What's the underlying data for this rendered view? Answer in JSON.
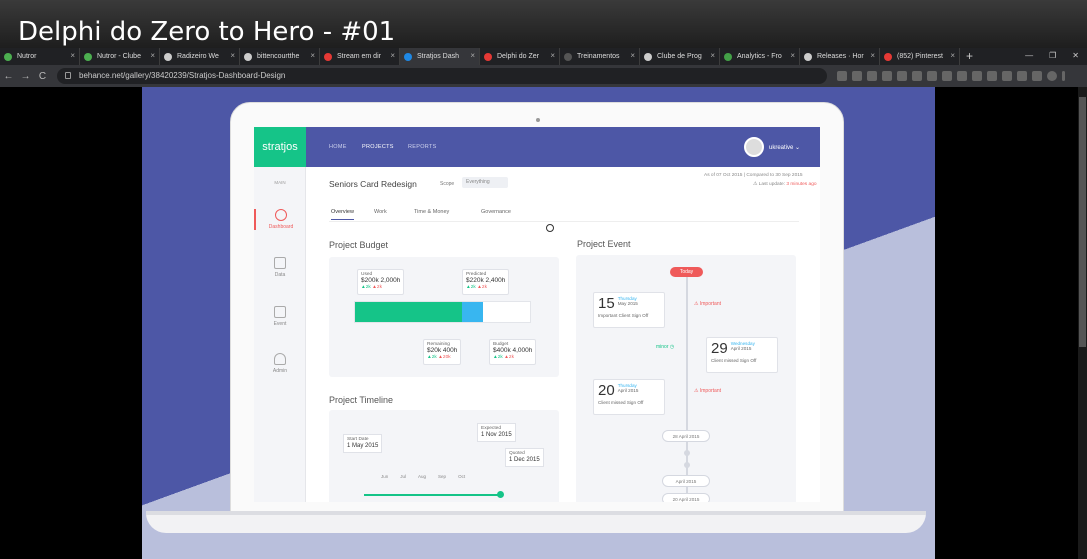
{
  "video": {
    "title": "Delphi do Zero to Hero - #01"
  },
  "browser": {
    "tabs": [
      {
        "label": "Nutror",
        "color": "#4caf50"
      },
      {
        "label": "Nutror - Clube",
        "color": "#4caf50"
      },
      {
        "label": "Radizeiro We",
        "color": "#cccccc"
      },
      {
        "label": "bittencourtthe",
        "color": "#cccccc"
      },
      {
        "label": "Stream em dir",
        "color": "#e53935"
      },
      {
        "label": "Stratjos Dash",
        "color": "#1e88e5"
      },
      {
        "label": "Delphi do Zer",
        "color": "#e53935"
      },
      {
        "label": "Treinamentos",
        "color": "#555555"
      },
      {
        "label": "Clube de Prog",
        "color": "#cccccc"
      },
      {
        "label": "Analytics - Fro",
        "color": "#43a047"
      },
      {
        "label": "Releases · Hor",
        "color": "#cccccc"
      },
      {
        "label": "(852) Pinterest",
        "color": "#e53935"
      }
    ],
    "active_tab": 5,
    "new_tab": "+",
    "url": "behance.net/gallery/38420239/Stratjos-Dashboard-Design",
    "back": "←",
    "forward": "→",
    "reload": "C",
    "win_min": "—",
    "win_max": "❐",
    "win_close": "✕"
  },
  "app": {
    "logo": "stratjos",
    "nav": [
      "HOME",
      "PROJECTS",
      "REPORTS"
    ],
    "active_nav": 1,
    "user": "ukreative",
    "user_caret": "⌄",
    "sidebar_main": "MAIN",
    "sidebar": [
      "Dashboard",
      "Data",
      "Event",
      "Admin"
    ],
    "project": "Seniors Card Redesign",
    "scope_label": "Scope",
    "scope_value": "Everything",
    "as_of": "As of 07 Oct 2015",
    "compared": "Compared to 30 Sep 2015",
    "last_update_label": "Last update:",
    "last_update": "3 minutes ago",
    "subtabs": [
      "Overview",
      "Work",
      "Time & Money",
      "Governance"
    ],
    "budget": {
      "title": "Project Budget",
      "used": {
        "label": "Used",
        "value": "$200k 2,000h",
        "d1": "▲2k",
        "d2": "▲2k"
      },
      "predicted": {
        "label": "Predicted",
        "value": "$220k 2,400h",
        "d1": "▲2k",
        "d2": "▲2k"
      },
      "remaining": {
        "label": "Remaining",
        "value": "$20k 400h",
        "d1": "▲2k",
        "d2": "▲20k"
      },
      "budget": {
        "label": "Budget",
        "value": "$400k 4,000h",
        "d1": "▲2k",
        "d2": "▲2k"
      },
      "used_fraction": 0.61,
      "predicted_fraction": 0.12
    },
    "timeline": {
      "title": "Project Timeline",
      "start_label": "Start Date",
      "start": "1 May 2015",
      "expected_label": "Expected",
      "expected": "1 Nov 2015",
      "quoted_label": "Quoted",
      "quoted": "1 Dec 2015",
      "months": [
        "Jun",
        "Jul",
        "Aug",
        "Sep",
        "Oct"
      ]
    },
    "events": {
      "title": "Project Event",
      "today": "Today",
      "e1": {
        "day": "15",
        "weekday": "Thursday",
        "my": "May 2015",
        "desc": "Important Client Sign Off",
        "tag": "⚠ Important"
      },
      "e2": {
        "day": "29",
        "weekday": "Wednesday",
        "my": "April 2015",
        "desc": "Client missed Sign Off",
        "tag": "minor ◷"
      },
      "e3": {
        "day": "20",
        "weekday": "Thursday",
        "my": "April 2015",
        "desc": "Client missed Sign Off",
        "tag": "⚠ Important"
      },
      "d1": "28 April 2015",
      "d2": "20 April 2015"
    }
  }
}
